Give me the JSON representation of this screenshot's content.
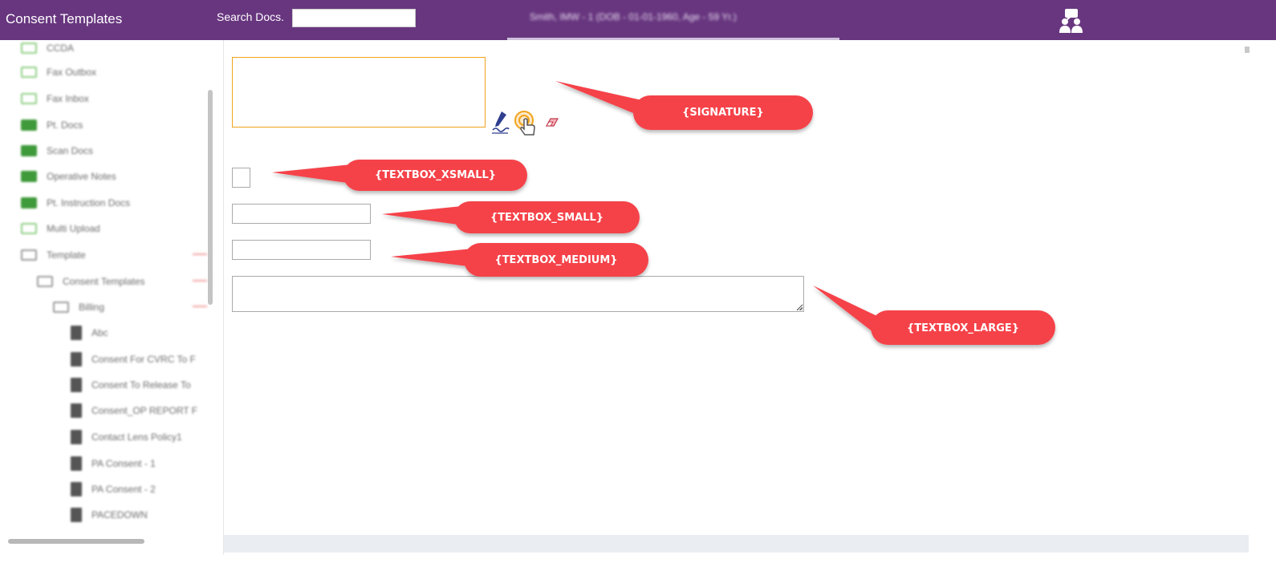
{
  "header": {
    "title": "Consent Templates",
    "search_label": "Search Docs.",
    "search_value": "",
    "patient_info": "Smith, IMW - 1     (DOB - 01-01-1960, Age - 59 Yr.)",
    "chat_icon": "chat-users-icon",
    "bg_color": "#68367f"
  },
  "sidebar": {
    "items": [
      {
        "label": "CCDA",
        "icon": "folder-outline-icon"
      },
      {
        "label": "Fax Outbox",
        "icon": "folder-outline-icon"
      },
      {
        "label": "Fax Inbox",
        "icon": "folder-outline-icon"
      },
      {
        "label": "Pt. Docs",
        "icon": "folder-filled-icon"
      },
      {
        "label": "Scan Docs",
        "icon": "folder-filled-icon"
      },
      {
        "label": "Operative Notes",
        "icon": "folder-filled-icon"
      },
      {
        "label": "Pt. Instruction Docs",
        "icon": "folder-filled-icon"
      },
      {
        "label": "Multi Upload",
        "icon": "folder-outline-icon"
      },
      {
        "label": "Template",
        "icon": "template-icon"
      },
      {
        "label": "Consent Templates",
        "icon": "template-icon"
      },
      {
        "label": "Billing",
        "icon": "template-icon"
      },
      {
        "label": "Abc",
        "icon": "document-icon"
      },
      {
        "label": "Consent For CVRC To F",
        "icon": "document-icon"
      },
      {
        "label": "Consent To Release To",
        "icon": "document-icon"
      },
      {
        "label": "Consent_OP REPORT F",
        "icon": "document-icon"
      },
      {
        "label": "Contact Lens Policy1",
        "icon": "document-icon"
      },
      {
        "label": "PA Consent - 1",
        "icon": "document-icon"
      },
      {
        "label": "PA Consent - 2",
        "icon": "document-icon"
      },
      {
        "label": "PACEDOWN",
        "icon": "document-icon"
      }
    ]
  },
  "main": {
    "signature": {
      "pen_icon": "signature-pen-icon",
      "touch_icon": "touch-sign-icon",
      "eraser_icon": "eraser-icon"
    },
    "fields": {
      "textbox_xsmall": "",
      "textbox_small": "",
      "textbox_medium": "",
      "textbox_large": ""
    }
  },
  "callouts": {
    "signature": "{SIGNATURE}",
    "textbox_xsmall": "{TEXTBOX_XSMALL}",
    "textbox_small": "{TEXTBOX_SMALL}",
    "textbox_medium": "{TEXTBOX_MEDIUM}",
    "textbox_large": "{TEXTBOX_LARGE}",
    "color": "#f5434a"
  }
}
